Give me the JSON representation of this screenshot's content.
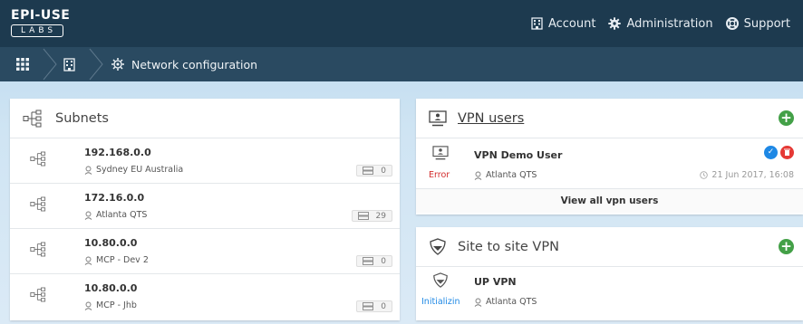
{
  "logo": {
    "top_text": "EPI-USE",
    "bottom_text": "LABS"
  },
  "topnav": {
    "account_label": "Account",
    "administration_label": "Administration",
    "support_label": "Support"
  },
  "breadcrumb": {
    "current_label": "Network configuration"
  },
  "subnets": {
    "title": "Subnets",
    "rows": [
      {
        "address": "192.168.0.0",
        "location": "Sydney EU Australia",
        "count": "0"
      },
      {
        "address": "172.16.0.0",
        "location": "Atlanta QTS",
        "count": "29"
      },
      {
        "address": "10.80.0.0",
        "location": "MCP - Dev 2",
        "count": "0"
      },
      {
        "address": "10.80.0.0",
        "location": "MCP - Jhb",
        "count": "0"
      }
    ]
  },
  "vpn_users": {
    "title": "VPN users",
    "user": {
      "name": "VPN Demo User",
      "location": "Atlanta QTS",
      "status": "Error",
      "date": "21 Jun 2017, 16:08"
    },
    "view_all_label": "View all vpn users"
  },
  "site_to_site": {
    "title": "Site to site VPN",
    "row": {
      "name": "UP VPN",
      "location": "Atlanta QTS",
      "status": "Initializin"
    }
  },
  "colors": {
    "topbar": "#1d3a4f",
    "crumbbar": "#2a4a61",
    "add_green": "#43a047",
    "error_red": "#d32f2f",
    "init_blue": "#1e88e5"
  }
}
